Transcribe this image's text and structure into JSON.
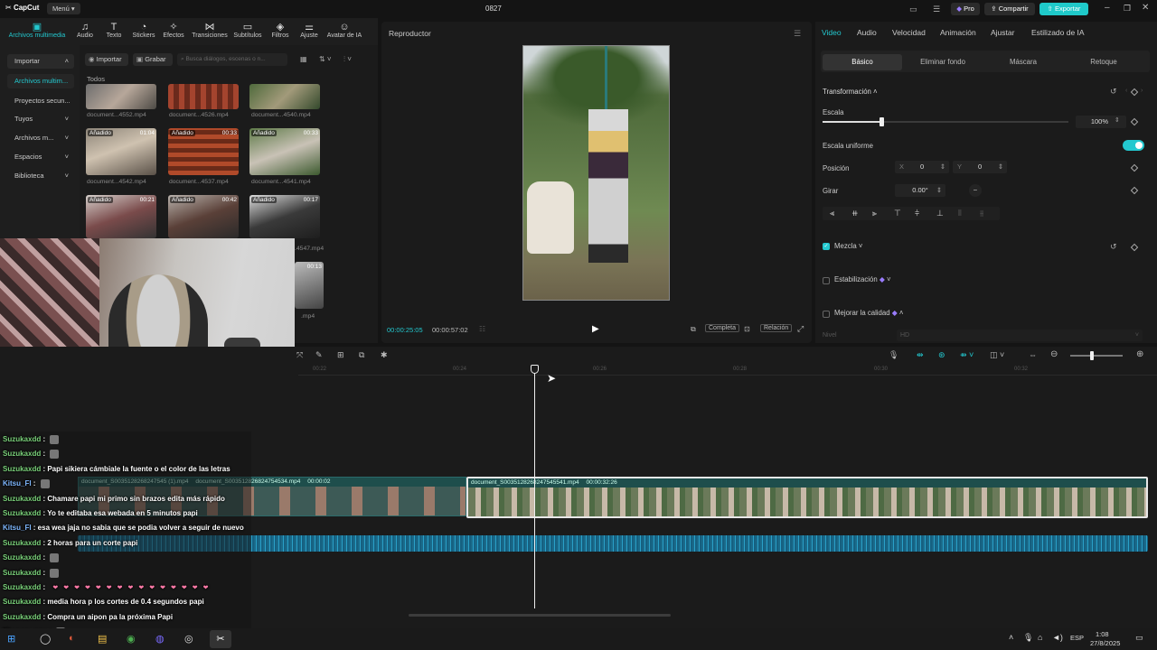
{
  "app": {
    "name": "CapCut",
    "menu": "Menú",
    "project": "0827",
    "pro": "Pro",
    "share": "Compartir",
    "export": "Exportar"
  },
  "tools": [
    {
      "icon": "media-icon",
      "label": "Archivos multimedia"
    },
    {
      "icon": "audio-icon",
      "label": "Audio"
    },
    {
      "icon": "text-icon",
      "label": "Texto"
    },
    {
      "icon": "stickers-icon",
      "label": "Stickers"
    },
    {
      "icon": "effects-icon",
      "label": "Efectos"
    },
    {
      "icon": "transitions-icon",
      "label": "Transiciones"
    },
    {
      "icon": "subtitles-icon",
      "label": "Subtítulos"
    },
    {
      "icon": "filters-icon",
      "label": "Filtros"
    },
    {
      "icon": "adjust-icon",
      "label": "Ajuste"
    },
    {
      "icon": "ai-avatar-icon",
      "label": "Avatar de IA"
    }
  ],
  "media": {
    "sidebar": [
      "Importar",
      "Archivos multim...",
      "Proyectos secun...",
      "Tuyos",
      "Archivos m...",
      "Espacios",
      "Biblioteca"
    ],
    "import": "Importar",
    "record": "Grabar",
    "search_placeholder": "Busca diálogos, escenas o n...",
    "all": "Todos",
    "thumbs": [
      {
        "name": "document...4552.mp4",
        "tag": "",
        "dur": ""
      },
      {
        "name": "document...4526.mp4",
        "tag": "",
        "dur": ""
      },
      {
        "name": "document...4540.mp4",
        "tag": "",
        "dur": ""
      },
      {
        "name": "document...4542.mp4",
        "tag": "Añadido",
        "dur": "01:04"
      },
      {
        "name": "document...4537.mp4",
        "tag": "Añadido",
        "dur": "00:33"
      },
      {
        "name": "document...4541.mp4",
        "tag": "Añadido",
        "dur": "00:33"
      },
      {
        "name": "",
        "tag": "Añadido",
        "dur": "00:21"
      },
      {
        "name": "",
        "tag": "Añadido",
        "dur": "00:42"
      },
      {
        "name": ".4547.mp4",
        "tag": "Añadido",
        "dur": "00:17"
      }
    ],
    "extra_dur": "00:13",
    "extra_name": ".mp4"
  },
  "player": {
    "title": "Reproductor",
    "current": "00:00:25:05",
    "total": "00:00:57:02",
    "btn_full": "Completa",
    "btn_ratio": "Relación"
  },
  "props": {
    "tabs": [
      "Video",
      "Audio",
      "Velocidad",
      "Animación",
      "Ajustar",
      "Estilizado de IA"
    ],
    "subtabs": [
      "Básico",
      "Eliminar fondo",
      "Máscara",
      "Retoque"
    ],
    "transform": "Transformación",
    "scale": "Escala",
    "scale_value": "100%",
    "scale_fraction": 0.24,
    "uniform": "Escala uniforme",
    "position": "Posición",
    "px_label": "X",
    "px": "0",
    "py_label": "Y",
    "py": "0",
    "rotate": "Girar",
    "rotate_value": "0.00°",
    "blend": "Mezcla",
    "stabilize": "Estabilización",
    "enhance": "Mejorar la calidad",
    "level": "Nivel",
    "level_value": "HD"
  },
  "timeline": {
    "ticks": [
      "00:22",
      "00:24",
      "00:26",
      "00:28",
      "00:30",
      "00:32"
    ],
    "clip1": "document_S0035128268247545 (1).mp4",
    "clip1_b": "document_S003512826824754534.mp4",
    "clip1_dur": "00:00:02",
    "clip2": "document_S0035128268247545541.mp4",
    "clip2_dur": "00:00:32:26"
  },
  "chat": [
    {
      "user": "Suzukaxdd",
      "cls": "u",
      "msg": "",
      "emote": true
    },
    {
      "user": "Suzukaxdd",
      "cls": "u",
      "msg": "",
      "emote": true
    },
    {
      "user": "Suzukaxdd",
      "cls": "u",
      "msg": "Papi sikiera cámbiale la fuente o el color de las letras"
    },
    {
      "user": "Kitsu_FI",
      "cls": "k",
      "msg": "",
      "emote": true
    },
    {
      "user": "Suzukaxdd",
      "cls": "u",
      "msg": "Chamare papi mi primo sin brazos edita más rápido"
    },
    {
      "user": "Suzukaxdd",
      "cls": "u",
      "msg": "Yo te editaba esa webada en 5 minutos papi"
    },
    {
      "user": "Kitsu_FI",
      "cls": "k",
      "msg": "esa wea jaja no sabia que se podia volver a seguir de nuevo"
    },
    {
      "user": "Suzukaxdd",
      "cls": "u",
      "msg": "2 horas para un corte papi"
    },
    {
      "user": "Suzukaxdd",
      "cls": "u",
      "msg": "",
      "emote": true
    },
    {
      "user": "Suzukaxdd",
      "cls": "u",
      "msg": "",
      "emote": true
    },
    {
      "user": "Suzukaxdd",
      "cls": "u",
      "msg": "",
      "hearts": true
    },
    {
      "user": "Suzukaxdd",
      "cls": "u",
      "msg": "media hora p los cortes de 0.4 segundos papi"
    },
    {
      "user": "Suzukaxdd",
      "cls": "u",
      "msg": "Compra un aipon pa la próxima Papi"
    },
    {
      "user": "Eleonor_ram",
      "cls": "e",
      "msg": "",
      "emote": true
    }
  ],
  "taskbar": {
    "lang": "ESP",
    "time": "1:08",
    "date": "27/8/2025"
  }
}
